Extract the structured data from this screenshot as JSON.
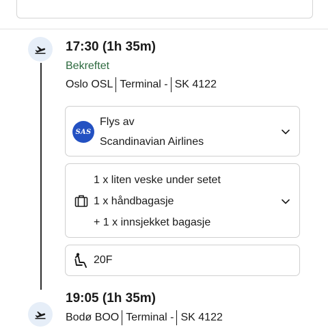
{
  "segment1": {
    "time": "17:30 (1h 35m)",
    "status": "Bekreftet",
    "airport": "Oslo OSL",
    "terminal": "Terminal -",
    "flight_number": "SK 4122"
  },
  "airline_card": {
    "logo_text": "SAS",
    "operated_by_label": "Flys av",
    "airline_name": "Scandinavian Airlines"
  },
  "baggage_card": {
    "items": [
      "1 x liten veske under setet",
      "1 x håndbagasje",
      "+ 1 x innsjekket bagasje"
    ]
  },
  "seat_card": {
    "seat": "20F"
  },
  "segment2": {
    "time": "19:05 (1h 35m)",
    "airport": "Bodø BOO",
    "terminal": "Terminal -",
    "flight_number": "SK 4122"
  },
  "colors": {
    "status_green": "#2d6a3f",
    "icon_circle_bg": "#e6eef8",
    "sas_blue": "#2351c2"
  }
}
